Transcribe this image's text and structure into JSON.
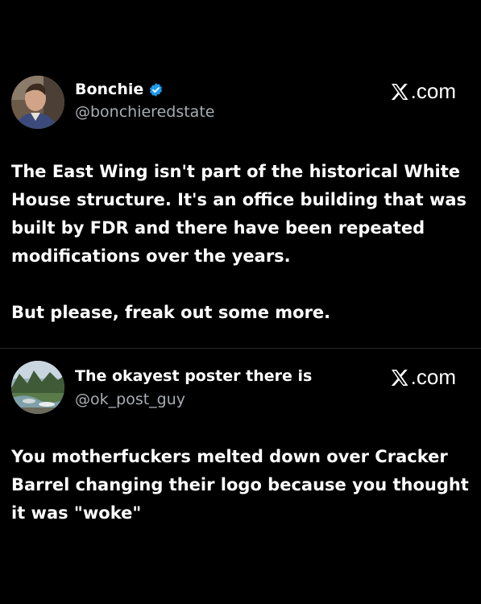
{
  "posts": [
    {
      "display_name": "Bonchie",
      "verified": true,
      "handle": "@bonchieredstate",
      "brand": ".com",
      "brand_icon": "x-logo-icon",
      "avatar_icon": "avatar-photo-man",
      "text_paragraphs": [
        "The East Wing isn't part of the historical White House structure. It's an office building that was built by FDR and there have been repeated modifications over the years.",
        "But please, freak out some more."
      ]
    },
    {
      "display_name": "The okayest poster there is",
      "verified": false,
      "handle": "@ok_post_guy",
      "brand": ".com",
      "brand_icon": "x-logo-icon",
      "avatar_icon": "avatar-photo-river-landscape",
      "text_paragraphs": [
        "You motherfuckers melted down over Cracker Barrel changing their logo because you thought it was \"woke\""
      ]
    }
  ],
  "colors": {
    "background": "#000000",
    "text": "#ffffff",
    "handle": "#a8adb3",
    "verified_badge": "#1d9bf0",
    "divider": "#2a2a2a"
  }
}
